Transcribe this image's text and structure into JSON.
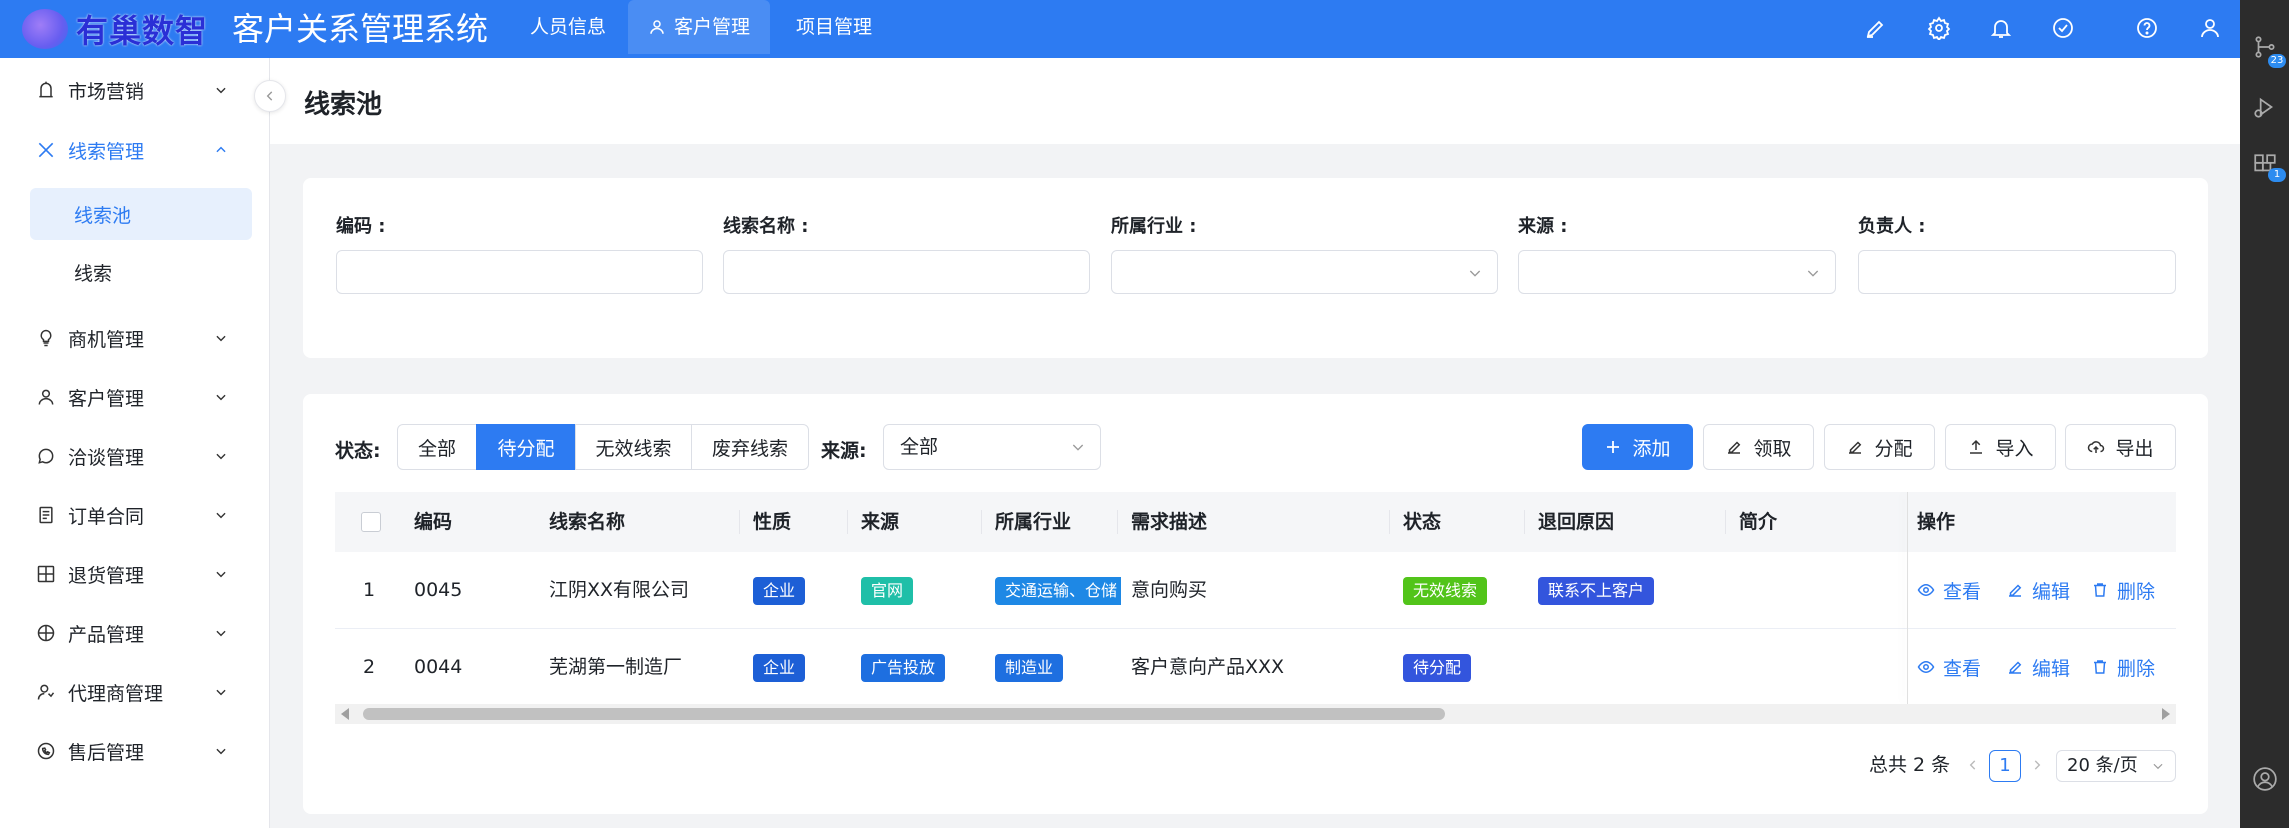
{
  "app": {
    "logo_text": "有巢数智",
    "title": "客户关系管理系统"
  },
  "topnav": [
    {
      "label": "人员信息"
    },
    {
      "label": "客户管理"
    },
    {
      "label": "项目管理"
    }
  ],
  "topbar_icons": [
    "brush-icon",
    "gear-icon",
    "bell-icon",
    "check-circle-icon",
    "help-icon",
    "user-icon"
  ],
  "right_strip": {
    "badges": [
      "23",
      "1"
    ]
  },
  "sidebar": {
    "items": [
      {
        "label": "市场营销",
        "icon": "marketing-icon"
      },
      {
        "label": "线索管理",
        "icon": "x-icon"
      },
      {
        "label": "线索池",
        "sub": true
      },
      {
        "label": "线索",
        "sub": true
      },
      {
        "label": "商机管理",
        "icon": "bulb-icon"
      },
      {
        "label": "客户管理",
        "icon": "user-icon"
      },
      {
        "label": "洽谈管理",
        "icon": "chat-icon"
      },
      {
        "label": "订单合同",
        "icon": "document-icon"
      },
      {
        "label": "退货管理",
        "icon": "return-icon"
      },
      {
        "label": "产品管理",
        "icon": "product-icon"
      },
      {
        "label": "代理商管理",
        "icon": "agent-icon"
      },
      {
        "label": "售后管理",
        "icon": "service-icon"
      }
    ]
  },
  "page": {
    "title": "线索池"
  },
  "filters": {
    "code_label": "编码 :",
    "name_label": "线索名称 :",
    "industry_label": "所属行业 :",
    "source_label": "来源 :",
    "owner_label": "负责人 :"
  },
  "toolbar": {
    "status_label": "状态:",
    "segments": [
      "全部",
      "待分配",
      "无效线索",
      "废弃线索"
    ],
    "source_label": "来源:",
    "source_value": "全部",
    "add": "添加",
    "claim": "领取",
    "assign": "分配",
    "import": "导入",
    "export": "导出"
  },
  "table": {
    "columns": [
      "编码",
      "线索名称",
      "性质",
      "来源",
      "所属行业",
      "需求描述",
      "状态",
      "退回原因",
      "简介",
      "操作"
    ],
    "rows": [
      {
        "index": "1",
        "code": "0045",
        "name": "江阴XX有限公司",
        "nature": "企业",
        "source": "官网",
        "industry": "交通运输、仓储",
        "demand": "意向购买",
        "status": "无效线索",
        "reason": "联系不上客户",
        "intro": ""
      },
      {
        "index": "2",
        "code": "0044",
        "name": "芜湖第一制造厂",
        "nature": "企业",
        "source": "广告投放",
        "industry": "制造业",
        "demand": "客户意向产品XXX",
        "status": "待分配",
        "reason": "",
        "intro": ""
      }
    ],
    "ops": {
      "view": "查看",
      "edit": "编辑",
      "delete": "删除"
    }
  },
  "pagination": {
    "total": "总共 2 条",
    "current": "1",
    "page_size": "20 条/页"
  },
  "colors": {
    "primary": "#2d7bf2",
    "tag_blue": "#1d5fd6",
    "tag_teal": "#1fbfa8",
    "tag_sky": "#1e88e5",
    "tag_green": "#52c41a",
    "tag_indigo": "#3355dd"
  }
}
